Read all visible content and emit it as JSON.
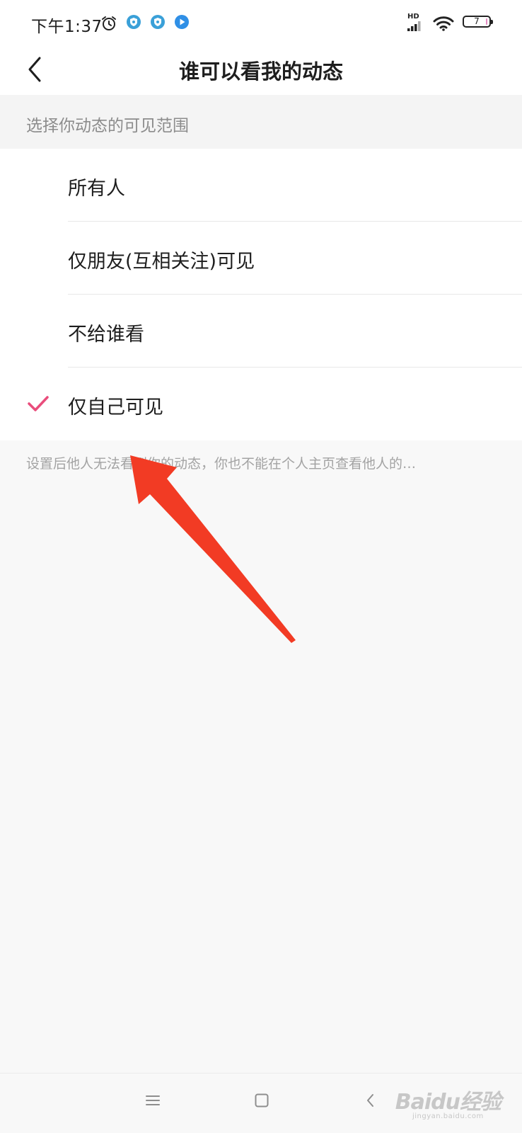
{
  "status_bar": {
    "time": "下午1:37",
    "network_label": "HD",
    "battery_level": "7",
    "icons": [
      "alarm-icon",
      "shield-app-icon",
      "shield-app-icon",
      "play-app-icon",
      "signal-icon",
      "wifi-icon",
      "battery-icon"
    ]
  },
  "header": {
    "title": "谁可以看我的动态",
    "back_icon": "chevron-left-icon"
  },
  "section": {
    "label": "选择你动态的可见范围"
  },
  "options": [
    {
      "label": "所有人",
      "selected": false
    },
    {
      "label": "仅朋友(互相关注)可见",
      "selected": false
    },
    {
      "label": "不给谁看",
      "selected": false
    },
    {
      "label": "仅自己可见",
      "selected": true
    }
  ],
  "footnote": "设置后他人无法看到你的动态，你也不能在个人主页查看他人的…",
  "colors": {
    "accent": "#e94d7c",
    "annotation_arrow": "#f23b24"
  },
  "nav_bar": {
    "icons": [
      "menu-icon",
      "home-square-icon",
      "back-chevron-icon"
    ]
  },
  "watermark": {
    "main": "Baidu经验",
    "sub": "jingyan.baidu.com"
  }
}
